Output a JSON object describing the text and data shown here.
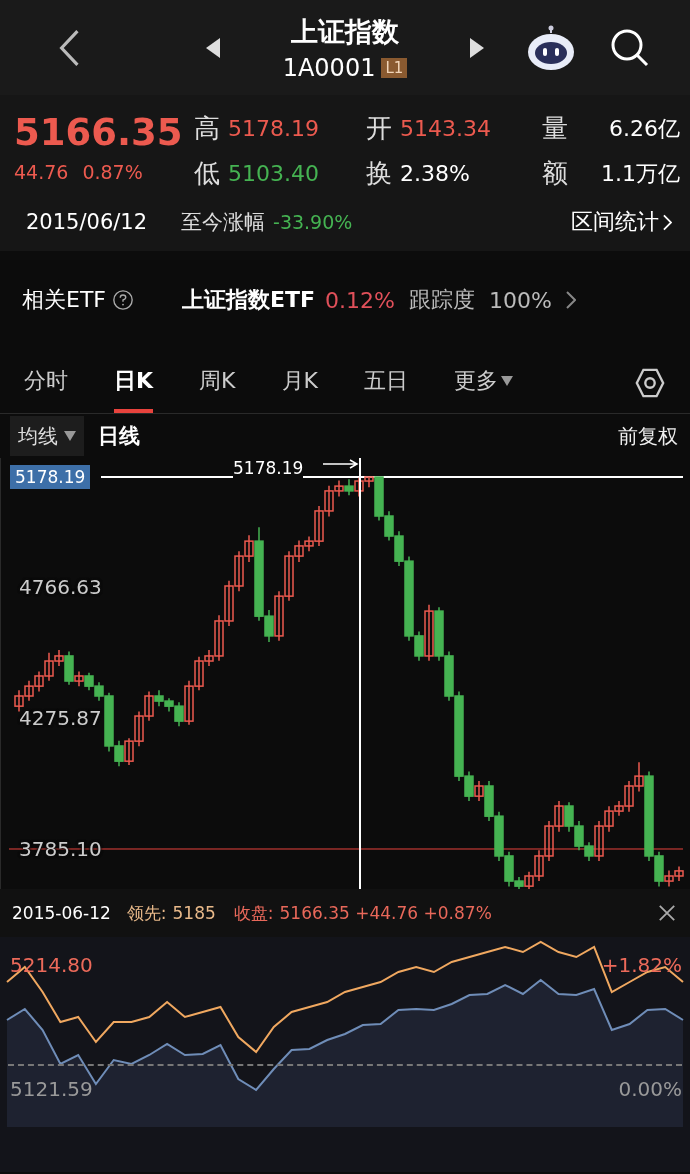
{
  "header": {
    "title": "上证指数",
    "code": "1A0001",
    "level_badge": "L1"
  },
  "quote": {
    "price": "5166.35",
    "change": "44.76",
    "change_pct": "0.87%",
    "stats": [
      {
        "label": "高",
        "value": "5178.19",
        "color": "#ec5a4f"
      },
      {
        "label": "开",
        "value": "5143.34",
        "color": "#ec5a4f"
      },
      {
        "label": "量",
        "value": "6.26亿",
        "color": "#ffffff"
      },
      {
        "label": "低",
        "value": "5103.40",
        "color": "#45b352"
      },
      {
        "label": "换",
        "value": "2.38%",
        "color": "#ffffff"
      },
      {
        "label": "额",
        "value": "1.1万亿",
        "color": "#ffffff"
      }
    ],
    "date": "2015/06/12",
    "since_label": "至今涨幅",
    "since_value": "-33.90%",
    "range_stats": "区间统计"
  },
  "etf": {
    "label": "相关ETF",
    "name": "上证指数ETF",
    "change": "0.12%",
    "tracking_label": "跟踪度",
    "tracking_value": "100%"
  },
  "tabs": [
    {
      "label": "分时",
      "selected": false,
      "kind": "plain"
    },
    {
      "label": "日K",
      "selected": true,
      "kind": "plain"
    },
    {
      "label": "周K",
      "selected": false,
      "kind": "plain"
    },
    {
      "label": "月K",
      "selected": false,
      "kind": "plain"
    },
    {
      "label": "五日",
      "selected": false,
      "kind": "plain"
    },
    {
      "label": "更多",
      "selected": false,
      "kind": "dropdown"
    }
  ],
  "sub_bar": {
    "indicator": "均线",
    "period": "日线",
    "adjust": "前复权"
  },
  "kline": {
    "high_marker": "5178.19",
    "chart_data": {
      "type": "candlestick",
      "ylim": [
        3635.3,
        5249.3
      ],
      "ref_lines": [
        {
          "axis": "y",
          "value": 5178.19,
          "label": "5178.19",
          "color": "#ffffff"
        },
        {
          "axis": "y",
          "value": 3785.1,
          "color": "#e8433d"
        }
      ],
      "yticks": [
        {
          "value": 4766.63,
          "label": "4766.63"
        },
        {
          "value": 4275.87,
          "label": "4275.87"
        },
        {
          "value": 3785.1,
          "label": "3785.10"
        }
      ],
      "ohlc": [
        [
          4320,
          4380,
          4300,
          4358
        ],
        [
          4358,
          4415,
          4340,
          4395
        ],
        [
          4395,
          4450,
          4375,
          4433
        ],
        [
          4433,
          4520,
          4415,
          4489
        ],
        [
          4489,
          4530,
          4470,
          4508
        ],
        [
          4508,
          4525,
          4400,
          4414
        ],
        [
          4414,
          4450,
          4395,
          4433
        ],
        [
          4433,
          4445,
          4380,
          4395
        ],
        [
          4395,
          4410,
          4340,
          4358
        ],
        [
          4358,
          4370,
          4150,
          4171
        ],
        [
          4171,
          4190,
          4095,
          4114
        ],
        [
          4114,
          4200,
          4100,
          4189
        ],
        [
          4189,
          4300,
          4170,
          4283
        ],
        [
          4283,
          4375,
          4265,
          4358
        ],
        [
          4358,
          4380,
          4320,
          4339
        ],
        [
          4339,
          4350,
          4300,
          4320
        ],
        [
          4320,
          4335,
          4245,
          4264
        ],
        [
          4264,
          4415,
          4250,
          4395
        ],
        [
          4395,
          4505,
          4380,
          4489
        ],
        [
          4489,
          4530,
          4470,
          4508
        ],
        [
          4508,
          4660,
          4490,
          4639
        ],
        [
          4639,
          4790,
          4620,
          4770
        ],
        [
          4770,
          4900,
          4750,
          4882
        ],
        [
          4882,
          4960,
          4860,
          4938
        ],
        [
          4938,
          4990,
          4640,
          4657
        ],
        [
          4657,
          4680,
          4560,
          4583
        ],
        [
          4583,
          4750,
          4565,
          4732
        ],
        [
          4732,
          4900,
          4715,
          4882
        ],
        [
          4882,
          4940,
          4860,
          4920
        ],
        [
          4920,
          4955,
          4900,
          4938
        ],
        [
          4938,
          5070,
          4920,
          5051
        ],
        [
          5051,
          5145,
          5030,
          5126
        ],
        [
          5126,
          5165,
          5105,
          5144
        ],
        [
          5144,
          5170,
          5110,
          5126
        ],
        [
          5126,
          5175,
          5105,
          5163
        ],
        [
          5163,
          5178,
          5140,
          5178
        ],
        [
          5178,
          5178,
          5015,
          5032
        ],
        [
          5032,
          5050,
          4940,
          4957
        ],
        [
          4957,
          4975,
          4845,
          4863
        ],
        [
          4863,
          4880,
          4565,
          4583
        ],
        [
          4583,
          4600,
          4490,
          4508
        ],
        [
          4508,
          4700,
          4490,
          4676
        ],
        [
          4676,
          4690,
          4490,
          4508
        ],
        [
          4508,
          4525,
          4340,
          4358
        ],
        [
          4358,
          4375,
          4040,
          4058
        ],
        [
          4058,
          4075,
          3965,
          3983
        ],
        [
          3983,
          4040,
          3965,
          4021
        ],
        [
          4021,
          4040,
          3890,
          3908
        ],
        [
          3908,
          3925,
          3740,
          3759
        ],
        [
          3759,
          3775,
          3645,
          3665
        ],
        [
          3665,
          3680,
          3630,
          3646
        ],
        [
          3646,
          3700,
          3630,
          3684
        ],
        [
          3684,
          3780,
          3665,
          3759
        ],
        [
          3759,
          3890,
          3740,
          3871
        ],
        [
          3871,
          3965,
          3850,
          3946
        ],
        [
          3946,
          3960,
          3850,
          3871
        ],
        [
          3871,
          3890,
          3780,
          3796
        ],
        [
          3796,
          3810,
          3740,
          3759
        ],
        [
          3759,
          3890,
          3740,
          3871
        ],
        [
          3871,
          3945,
          3850,
          3927
        ],
        [
          3927,
          3965,
          3910,
          3946
        ],
        [
          3946,
          4040,
          3925,
          4021
        ],
        [
          4021,
          4110,
          4000,
          4058
        ],
        [
          4058,
          4075,
          3740,
          3759
        ],
        [
          3759,
          3775,
          3645,
          3665
        ],
        [
          3665,
          3705,
          3645,
          3684
        ],
        [
          3684,
          3720,
          3665,
          3703
        ]
      ]
    }
  },
  "tooltip": {
    "date": "2015-06-12",
    "lead_label": "领先:",
    "lead_value": "5185",
    "close_label": "收盘:",
    "close_value": "5166.35 +44.76 +0.87%"
  },
  "intraday": {
    "top_price": "5214.80",
    "top_pct": "+1.82%",
    "base_price": "5121.59",
    "base_pct": "0.00%"
  }
}
